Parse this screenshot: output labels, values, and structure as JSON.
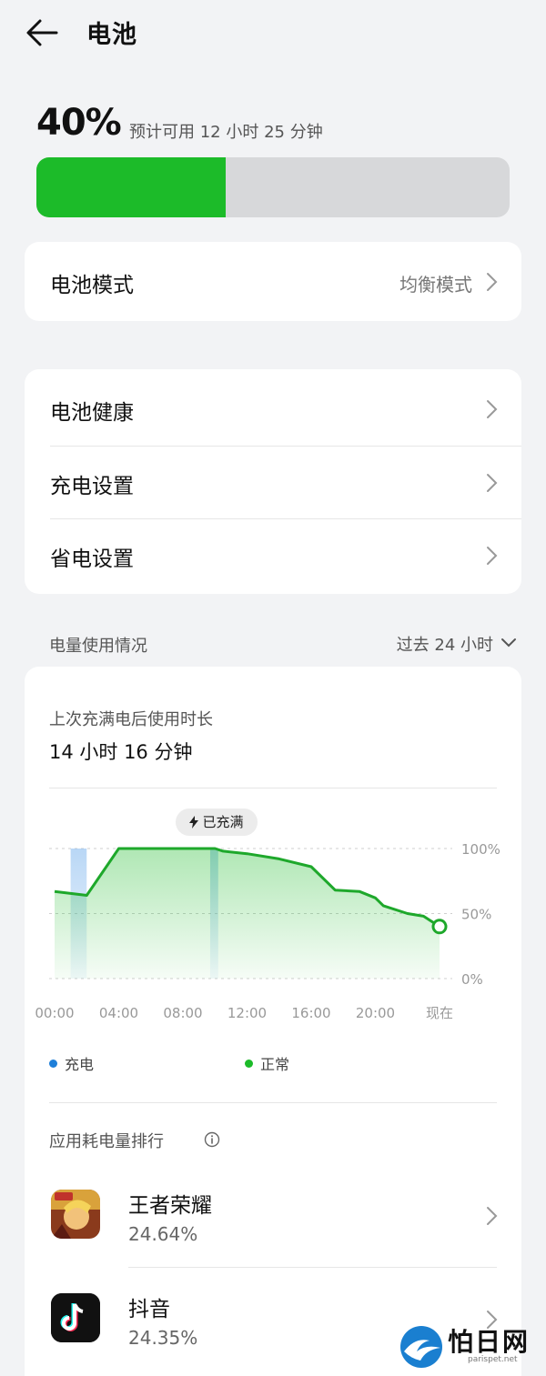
{
  "header": {
    "title": "电池"
  },
  "battery": {
    "percent_label": "40%",
    "level": 0.4,
    "estimate": "预计可用 12 小时 25 分钟",
    "fill_color": "#1cbb29"
  },
  "mode": {
    "label": "电池模式",
    "value": "均衡模式"
  },
  "settings": [
    {
      "label": "电池健康"
    },
    {
      "label": "充电设置"
    },
    {
      "label": "省电设置"
    }
  ],
  "usage": {
    "section_title": "电量使用情况",
    "period": "过去 24 小时",
    "since_full_label": "上次充满电后使用时长",
    "since_full_value": "14 小时 16 分钟",
    "badge": "已充满",
    "legend": [
      {
        "label": "充电",
        "color": "#1e7fd9"
      },
      {
        "label": "正常",
        "color": "#1cbb29"
      }
    ]
  },
  "chart_data": {
    "type": "area",
    "x": [
      0,
      2,
      4,
      6,
      8,
      10,
      10.5,
      12,
      14,
      16,
      17.5,
      19,
      20,
      20.5,
      22,
      23,
      24
    ],
    "x_tick_labels": [
      "00:00",
      "04:00",
      "08:00",
      "12:00",
      "16:00",
      "20:00",
      "现在"
    ],
    "x_ticks": [
      0,
      4,
      8,
      12,
      16,
      20,
      24
    ],
    "y": [
      67,
      64,
      100,
      100,
      100,
      100,
      98,
      96,
      92,
      86,
      68,
      67,
      62,
      56,
      50,
      48,
      40
    ],
    "y_tick_labels": [
      "100%",
      "50%",
      "0%"
    ],
    "y_ticks": [
      100,
      50,
      0
    ],
    "ylim": [
      0,
      100
    ],
    "charging_ranges": [
      [
        1.0,
        2.0
      ],
      [
        9.7,
        10.2
      ]
    ],
    "full_charge_at": 10
  },
  "ranking": {
    "title": "应用耗电量排行",
    "apps": [
      {
        "name": "王者荣耀",
        "percent": "24.64%"
      },
      {
        "name": "抖音",
        "percent": "24.35%"
      }
    ]
  },
  "watermark": {
    "brand": "怕日网",
    "url": "parispet.net"
  }
}
